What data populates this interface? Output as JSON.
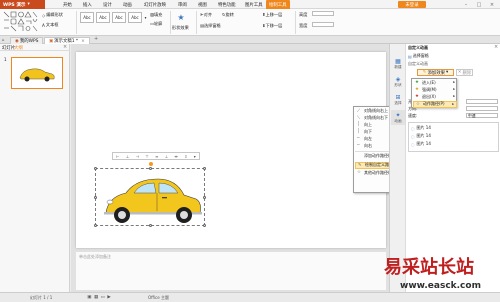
{
  "app": {
    "name": "WPS 演示",
    "accent": "#f0871d",
    "brand": "#c94a1d"
  },
  "menubar": {
    "tabs": [
      "开始",
      "插入",
      "设计",
      "动画",
      "幻灯片放映",
      "审阅",
      "视图",
      "特色功能",
      "图片工具",
      "绘制工具"
    ],
    "active": "绘制工具",
    "login": "未登录"
  },
  "ribbon": {
    "left": [
      "编辑形状",
      "文本框"
    ],
    "styles": [
      "Abc",
      "Abc",
      "Abc",
      "Abc"
    ],
    "fill": "填充",
    "outline": "轮廓",
    "shape_effect": "形状效果",
    "align": "对齐",
    "rotate": "旋转",
    "select": "选择窗格",
    "layer_up": "上移一层",
    "layer_down": "下移一层",
    "height_label": "高度",
    "height": "",
    "width_label": "宽度",
    "width": ""
  },
  "doctabs": [
    "我的WPS",
    "演示文稿1 *"
  ],
  "left": {
    "tabs": [
      "幻灯片",
      "大纲"
    ],
    "slide_no": "1"
  },
  "toolbar_icons": [
    "align-left-icon",
    "align-center-icon",
    "align-right-icon",
    "align-top-icon",
    "align-middle-icon",
    "align-bottom-icon",
    "distribute-h-icon",
    "distribute-v-icon",
    "more-icon"
  ],
  "notes": "单击此处添加备注",
  "rpane": {
    "side": [
      "新建",
      "形状",
      "选择",
      "动画"
    ],
    "title": "自定义动画",
    "select_pane": "选择窗格",
    "section": "自定义动画",
    "add_effect": "添加效果",
    "delete": "删除",
    "modify": "修改",
    "start_label": "开始:",
    "direction_label": "方向:",
    "speed_label": "速度:",
    "speed": "中速",
    "list": [
      "图片 14",
      "图片 14",
      "图片 14"
    ]
  },
  "effect_menu": [
    "进入(E)",
    "强调(M)",
    "退出(X)",
    "动作路径(P)"
  ],
  "path_menu": [
    "对角线向右上",
    "对角线向右下",
    "向上",
    "向下",
    "向左",
    "向右",
    "添加动作路径(A)...",
    "绘制自定义路径(D)",
    "其他动作路径(M)..."
  ],
  "custom_menu": [
    "直线(L)",
    "曲线(C)",
    "任意多边形(F)",
    "自由曲线(S)"
  ],
  "status": {
    "slide": "幻灯片 1 / 1",
    "theme": "Office 主题",
    "zoom": ""
  },
  "watermark": {
    "cn": "易采站长站",
    "url": "www.easck.com"
  }
}
